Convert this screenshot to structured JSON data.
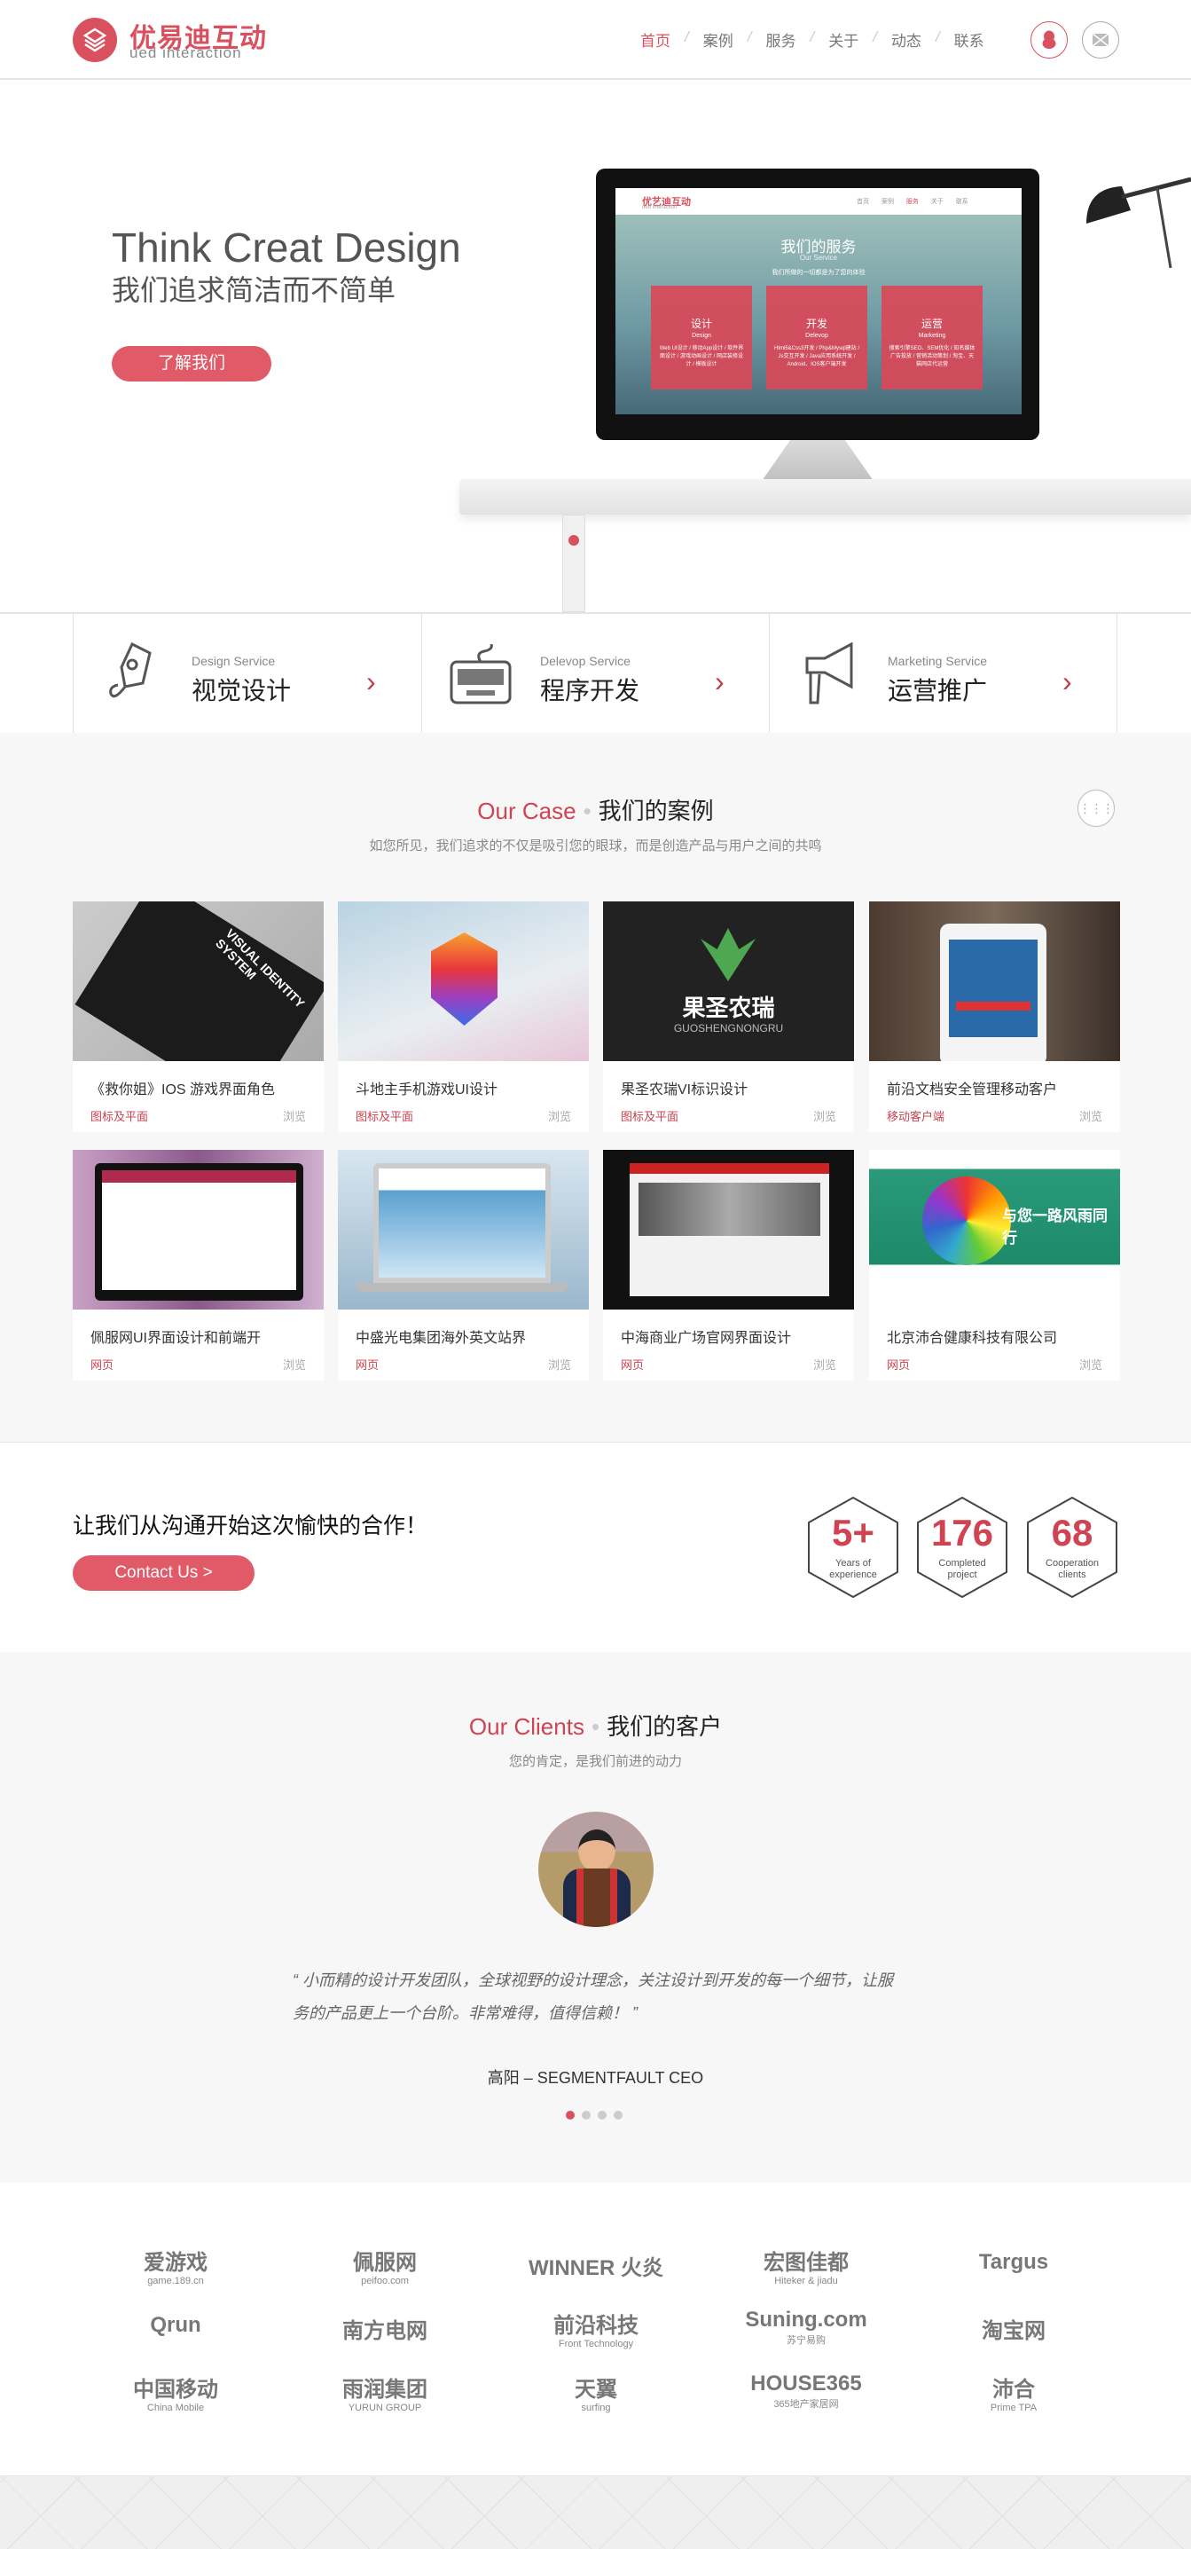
{
  "header": {
    "logo_cn": "优易迪互动",
    "logo_en": "ued interaction",
    "nav": [
      {
        "label": "首页",
        "active": true
      },
      {
        "label": "案例"
      },
      {
        "label": "服务"
      },
      {
        "label": "关于"
      },
      {
        "label": "动态"
      },
      {
        "label": "联系"
      }
    ],
    "icons": [
      "qq-icon",
      "mail-icon"
    ]
  },
  "hero": {
    "title": "Think Creat Design",
    "subtitle": "我们追求简洁而不简单",
    "button": "了解我们",
    "screen": {
      "logo": "优艺迪互动",
      "logo_en": "ued interaction",
      "nav": [
        "首页",
        "案例",
        "服务",
        "关于",
        "联系"
      ],
      "title": "我们的服务",
      "title_en": "Our Service",
      "tagline": "我们所做的一切都是为了您的体验",
      "cards": [
        {
          "cn": "设计",
          "en": "Design",
          "items": "Web UI设计 / 移动App设计 / 软件界面设计 / 游戏动画设计 / 网店装修设计 / 模板设计"
        },
        {
          "cn": "开发",
          "en": "Delevop",
          "items": "Html5&Css3开发 / Php&Mysql建站 / Js交互开发 / Java应用系统开发 / Android、IOS客户端开发"
        },
        {
          "cn": "运营",
          "en": "Marketing",
          "items": "搜索引擎SEO、SEM优化 / 知名媒体广告投放 / 营销活动策划 / 淘宝、天猫网店代运营"
        }
      ]
    }
  },
  "services": [
    {
      "en": "Design Service",
      "cn": "视觉设计",
      "icon": "pen-icon"
    },
    {
      "en": "Delevop Service",
      "cn": "程序开发",
      "icon": "keyboard-icon"
    },
    {
      "en": "Marketing Service",
      "cn": "运营推广",
      "icon": "megaphone-icon"
    }
  ],
  "cases": {
    "title_en": "Our Case",
    "title_cn": "我们的案例",
    "subtitle": "如您所见，我们追求的不仅是吸引您的眼球，而是创造产品与用户之间的共鸣",
    "browse": "浏览",
    "items": [
      {
        "title": "《救你姐》IOS 游戏界面角色",
        "tag": "图标及平面"
      },
      {
        "title": "斗地主手机游戏UI设计",
        "tag": "图标及平面"
      },
      {
        "title": "果圣农瑞VI标识设计",
        "tag": "图标及平面",
        "img_text": "果圣农瑞",
        "img_sub": "GUOSHENGNONGRU"
      },
      {
        "title": "前沿文档安全管理移动客户",
        "tag": "移动客户端"
      },
      {
        "title": "佩服网UI界面设计和前端开",
        "tag": "网页"
      },
      {
        "title": "中盛光电集团海外英文站界",
        "tag": "网页"
      },
      {
        "title": "中海商业广场官网界面设计",
        "tag": "网页"
      },
      {
        "title": "北京沛合健康科技有限公司",
        "tag": "网页",
        "img_text": "与您一路风雨同行"
      }
    ]
  },
  "contact": {
    "heading": "让我们从沟通开始这次愉快的合作！",
    "button": "Contact Us >",
    "stats": [
      {
        "value": "5+",
        "label": "Years of experience"
      },
      {
        "value": "176",
        "label": "Completed project"
      },
      {
        "value": "68",
        "label": "Cooperation clients"
      }
    ]
  },
  "clients": {
    "title_en": "Our Clients",
    "title_cn": "我们的客户",
    "subtitle": "您的肯定，是我们前进的动力",
    "quote": "“ 小而精的设计开发团队，全球视野的设计理念，关注设计到开发的每一个细节，让服务的产品更上一个台阶。非常难得，值得信赖！ ”",
    "author": "高阳 – SEGMENTFAULT CEO",
    "slides": 4,
    "active_slide": 1
  },
  "logos": [
    {
      "name": "爱游戏",
      "sub": "game.189.cn"
    },
    {
      "name": "佩服网",
      "sub": "peifoo.com"
    },
    {
      "name": "WINNER 火炎",
      "sub": ""
    },
    {
      "name": "宏图佳都",
      "sub": "Hiteker & jiadu"
    },
    {
      "name": "Targus",
      "sub": ""
    },
    {
      "name": "Qrun",
      "sub": ""
    },
    {
      "name": "南方电网",
      "sub": ""
    },
    {
      "name": "前沿科技",
      "sub": "Front Technology"
    },
    {
      "name": "Suning.com",
      "sub": "苏宁易购"
    },
    {
      "name": "淘宝网",
      "sub": ""
    },
    {
      "name": "中国移动",
      "sub": "China Mobile"
    },
    {
      "name": "雨润集团",
      "sub": "YURUN GROUP"
    },
    {
      "name": "天翼",
      "sub": "surfing"
    },
    {
      "name": "HOUSE365",
      "sub": "365地产家居网"
    },
    {
      "name": "沛合",
      "sub": "Prime TPA"
    }
  ],
  "colors": {
    "accent": "#d9505e",
    "button": "#e05a68",
    "section_bg": "#f7f7f7"
  }
}
